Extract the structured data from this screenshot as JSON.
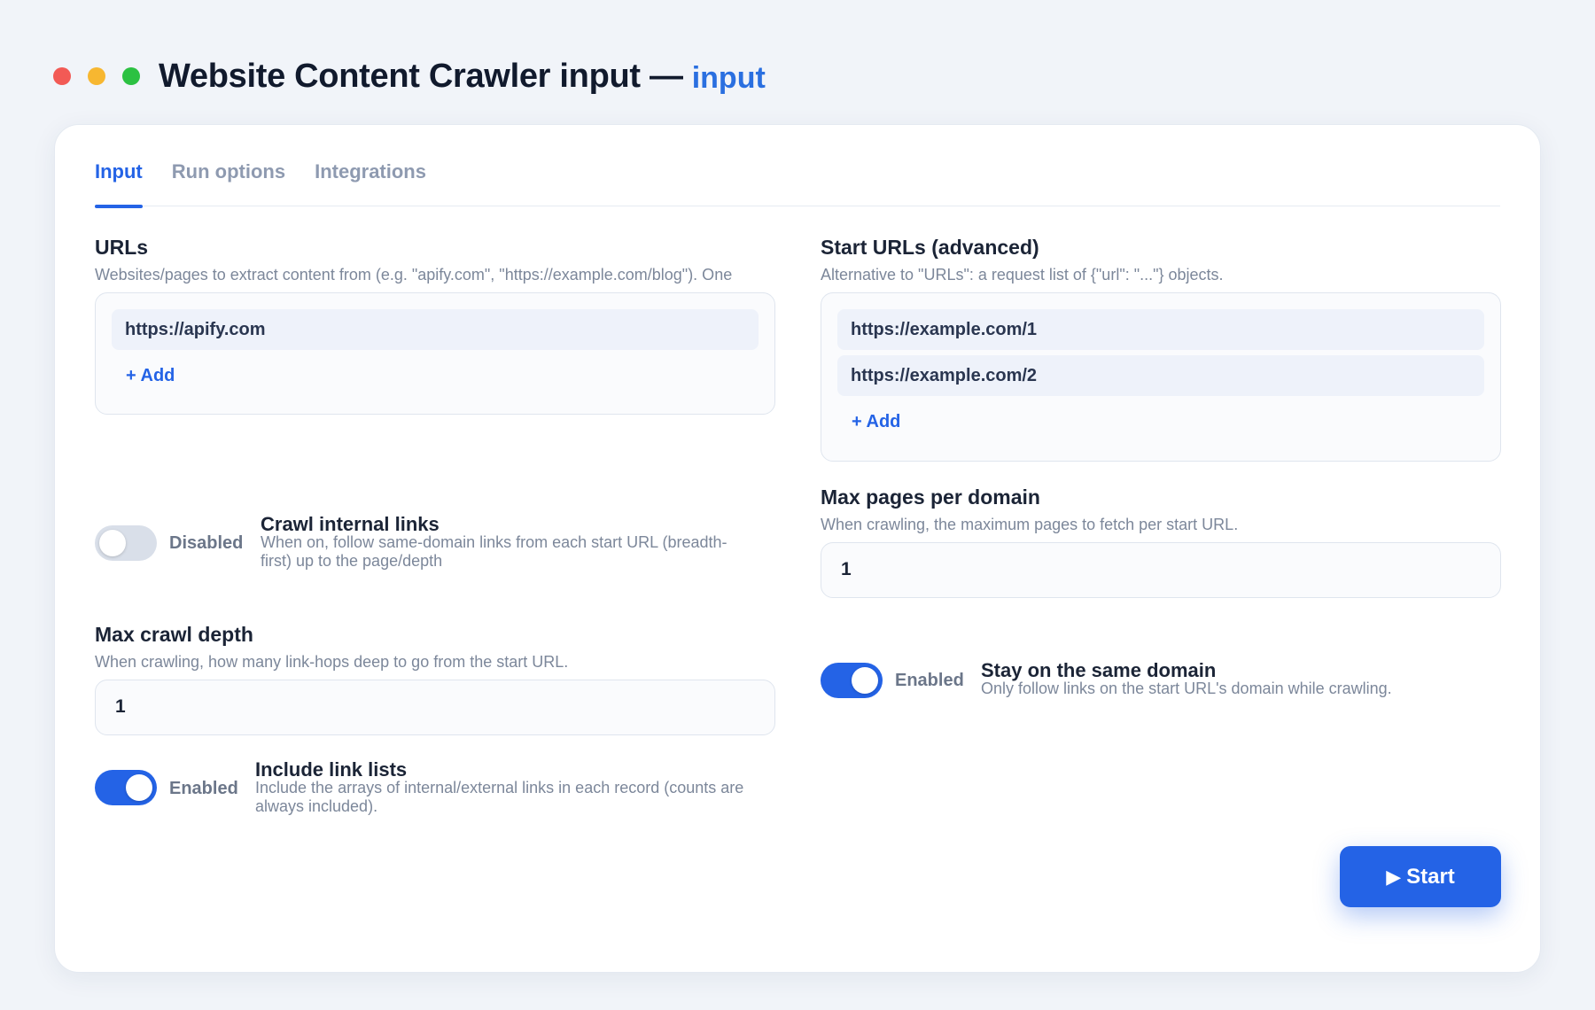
{
  "header": {
    "title": "Website Content Crawler input —",
    "suffix": "input"
  },
  "tabs": [
    {
      "label": "Input",
      "active": true
    },
    {
      "label": "Run options",
      "active": false
    },
    {
      "label": "Integrations",
      "active": false
    }
  ],
  "urls": {
    "label": "URLs",
    "description": "Websites/pages to extract content from (e.g. \"apify.com\", \"https://example.com/blog\"). One",
    "items": [
      "https://apify.com"
    ],
    "add_label": "+ Add"
  },
  "start_urls": {
    "label": "Start URLs (advanced)",
    "description": "Alternative to \"URLs\": a request list of {\"url\": \"...\"} objects.",
    "items": [
      "https://example.com/1",
      "https://example.com/2"
    ],
    "add_label": "+ Add"
  },
  "crawl_internal": {
    "state": "Disabled",
    "enabled": false,
    "title": "Crawl internal links",
    "description": "When on, follow same-domain links from each start URL (breadth-first) up to the page/depth"
  },
  "max_pages": {
    "label": "Max pages per domain",
    "description": "When crawling, the maximum pages to fetch per start URL.",
    "value": "1"
  },
  "max_depth": {
    "label": "Max crawl depth",
    "description": "When crawling, how many link-hops deep to go from the start URL.",
    "value": "1"
  },
  "same_domain": {
    "state": "Enabled",
    "enabled": true,
    "title": "Stay on the same domain",
    "description": "Only follow links on the start URL's domain while crawling."
  },
  "link_lists": {
    "state": "Enabled",
    "enabled": true,
    "title": "Include link lists",
    "description": "Include the arrays of internal/external links in each record (counts are always included)."
  },
  "start_button": {
    "icon": "▶",
    "label": "Start"
  },
  "colors": {
    "accent": "#2463e6",
    "background": "#f1f4f9",
    "dot_red": "#f25a55",
    "dot_yellow": "#f7b731",
    "dot_green": "#2cc142"
  }
}
